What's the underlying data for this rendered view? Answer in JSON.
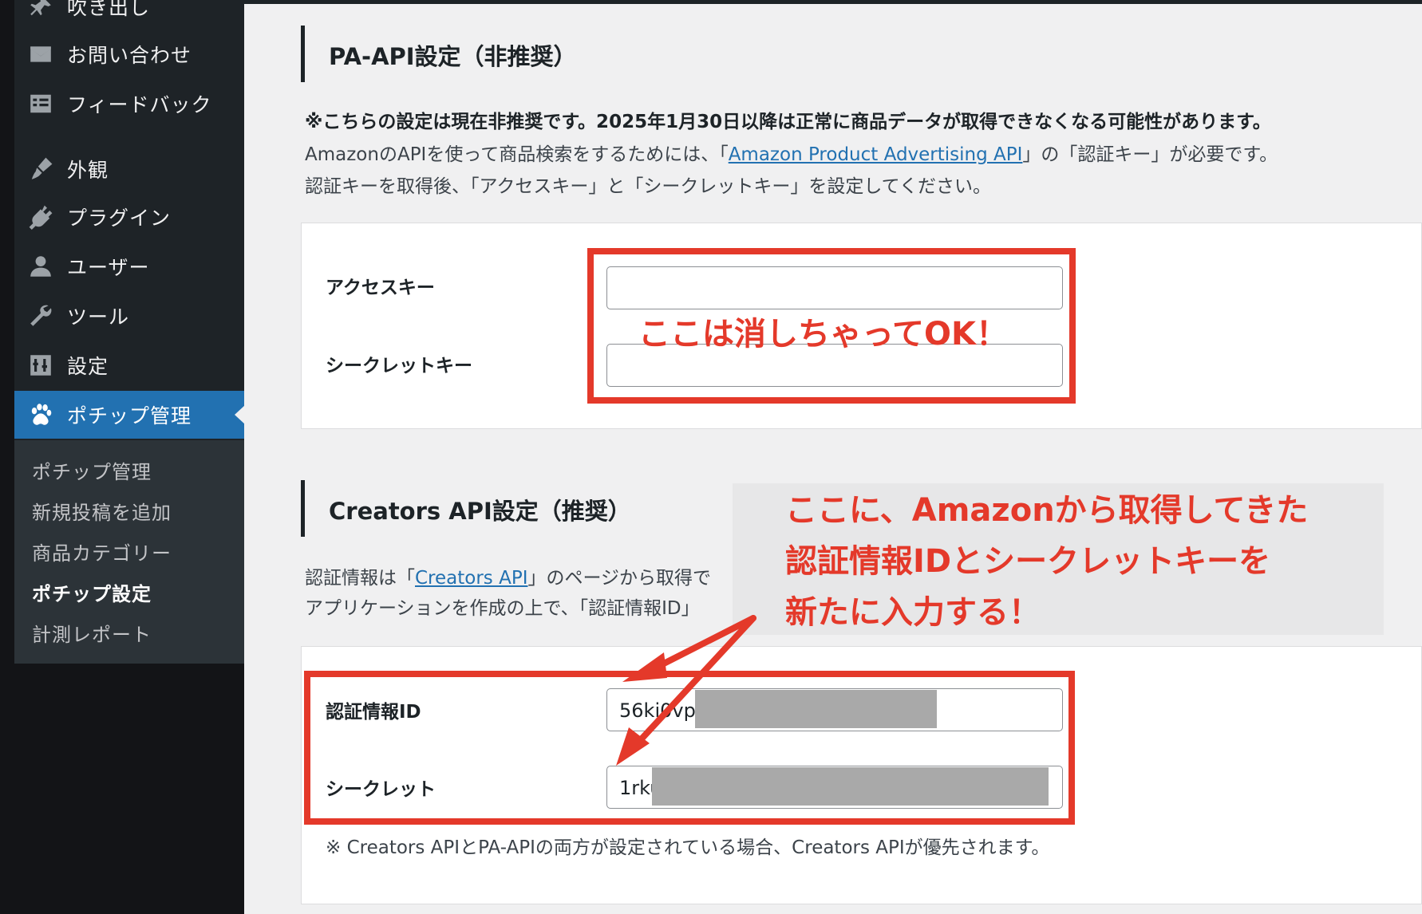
{
  "sidebar": {
    "items": [
      {
        "label": "吹き出し",
        "icon": "pin-icon"
      },
      {
        "label": "お問い合わせ",
        "icon": "mail-icon"
      },
      {
        "label": "フィードバック",
        "icon": "feedback-icon"
      },
      {
        "label": "外観",
        "icon": "brush-icon"
      },
      {
        "label": "プラグイン",
        "icon": "plugin-icon"
      },
      {
        "label": "ユーザー",
        "icon": "user-icon"
      },
      {
        "label": "ツール",
        "icon": "wrench-icon"
      },
      {
        "label": "設定",
        "icon": "settings-icon"
      },
      {
        "label": "ポチップ管理",
        "icon": "paw-icon"
      }
    ],
    "submenu": [
      {
        "label": "ポチップ管理"
      },
      {
        "label": "新規投稿を追加"
      },
      {
        "label": "商品カテゴリー"
      },
      {
        "label": "ポチップ設定"
      },
      {
        "label": "計測レポート"
      }
    ],
    "active_color": "#2271b1"
  },
  "pa_api": {
    "title": "PA-API設定（非推奨）",
    "warning": "※こちらの設定は現在非推奨です。2025年1月30日以降は正常に商品データが取得できなくなる可能性があります。",
    "line2_before": "AmazonのAPIを使って商品検索をするためには、「",
    "line2_link": "Amazon Product Advertising API",
    "line2_after": "」の「認証キー」が必要です。",
    "line3": "認証キーを取得後、「アクセスキー」と「シークレットキー」を設定してください。",
    "access_key_label": "アクセスキー",
    "access_key_value": "",
    "secret_key_label": "シークレットキー",
    "secret_key_value": ""
  },
  "creators_api": {
    "title": "Creators API設定（推奨）",
    "line1_before": "認証情報は「",
    "line1_link": "Creators API",
    "line1_after": "」のページから取得で",
    "line2": "アプリケーションを作成の上で、「認証情報ID」",
    "cred_id_label": "認証情報ID",
    "cred_id_value": "56ki0vp",
    "secret_label": "シークレット",
    "secret_value": "1rku",
    "note": "※ Creators APIとPA-APIの両方が設定されている場合、Creators APIが優先されます。"
  },
  "annotations": {
    "delete_ok": "ここは消しちゃってOK！",
    "callout_line1": "ここに、Amazonから取得してきた",
    "callout_line2": "認証情報IDとシークレットキーを",
    "callout_line3": "新たに入力する！",
    "color": "#e4392a"
  }
}
